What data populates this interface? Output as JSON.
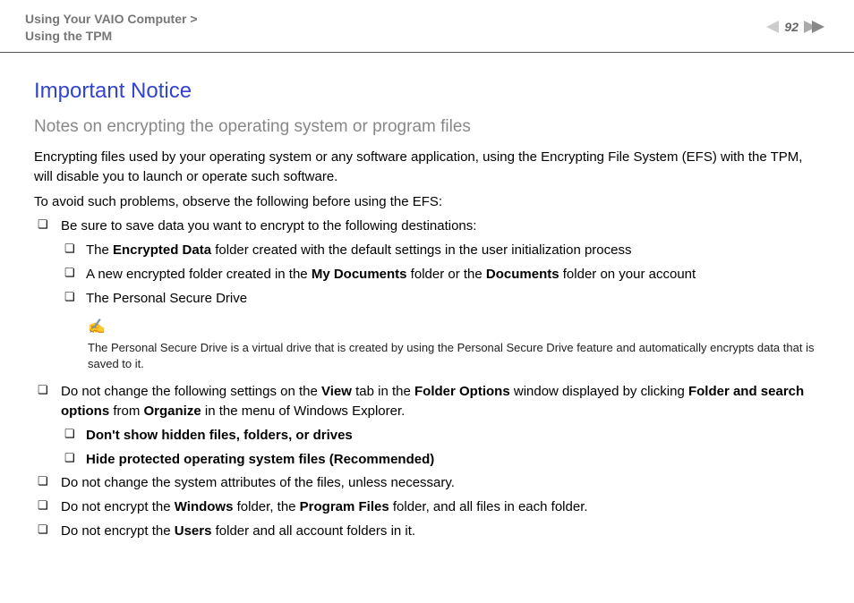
{
  "header": {
    "breadcrumb_line1": "Using Your VAIO Computer >",
    "breadcrumb_line2": "Using the TPM",
    "page_number": "92"
  },
  "main": {
    "title": "Important Notice",
    "subtitle": "Notes on encrypting the operating system or program files",
    "intro_p1": "Encrypting files used by your operating system or any software application, using the Encrypting File System (EFS) with the TPM, will disable you to launch or operate such software.",
    "intro_p2": "To avoid such problems, observe the following before using the EFS:",
    "item1_lead": "Be sure to save data you want to encrypt to the following destinations:",
    "item1_sub1_a": "The ",
    "item1_sub1_b": "Encrypted Data",
    "item1_sub1_c": " folder created with the default settings in the user initialization process",
    "item1_sub2_a": "A new encrypted folder created in the ",
    "item1_sub2_b": "My Documents",
    "item1_sub2_c": " folder or the ",
    "item1_sub2_d": "Documents",
    "item1_sub2_e": " folder on your account",
    "item1_sub3": "The Personal Secure Drive",
    "note_text": "The Personal Secure Drive is a virtual drive that is created by using the Personal Secure Drive feature and automatically encrypts data that is saved to it.",
    "item2_a": "Do not change the following settings on the ",
    "item2_b": "View",
    "item2_c": " tab in the ",
    "item2_d": "Folder Options",
    "item2_e": " window displayed by clicking ",
    "item2_f": "Folder and search options",
    "item2_g": " from ",
    "item2_h": "Organize",
    "item2_i": " in the menu of Windows Explorer.",
    "item2_sub1": "Don't show hidden files, folders, or drives",
    "item2_sub2": "Hide protected operating system files (Recommended)",
    "item3": "Do not change the system attributes of the files, unless necessary.",
    "item4_a": "Do not encrypt the ",
    "item4_b": "Windows",
    "item4_c": " folder, the ",
    "item4_d": "Program Files",
    "item4_e": " folder, and all files in each folder.",
    "item5_a": "Do not encrypt the ",
    "item5_b": "Users",
    "item5_c": " folder and all account folders in it."
  }
}
